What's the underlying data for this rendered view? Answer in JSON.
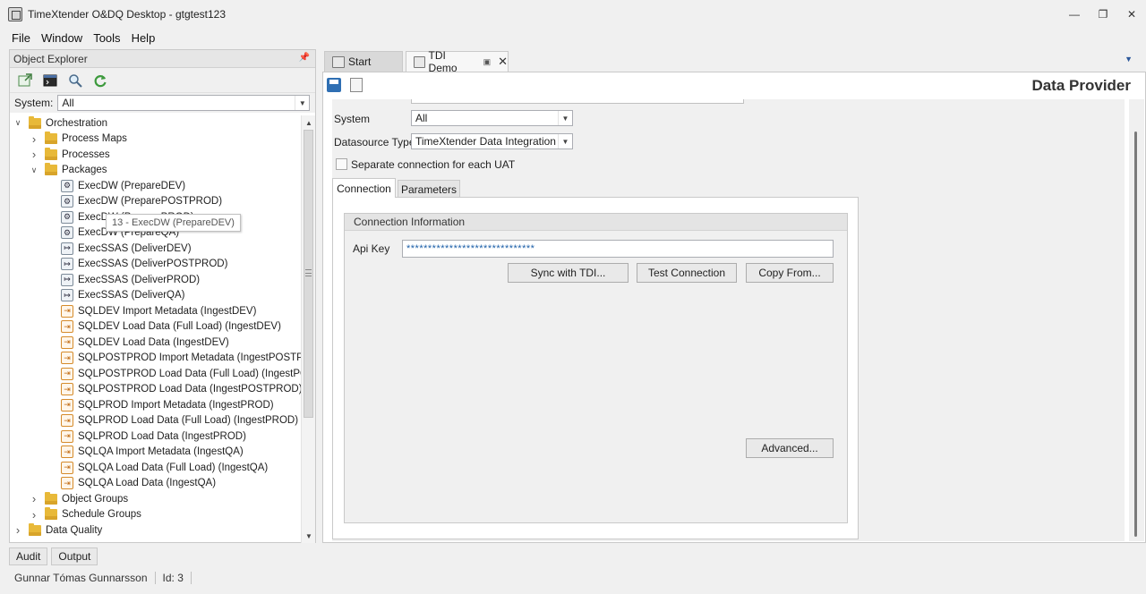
{
  "window": {
    "title": "TimeXtender O&DQ Desktop - gtgtest123"
  },
  "menu": [
    "File",
    "Window",
    "Tools",
    "Help"
  ],
  "explorer": {
    "header": "Object Explorer",
    "system_label": "System:",
    "system_value": "All",
    "tooltip": "13 - ExecDW (PrepareDEV)",
    "tree": [
      {
        "label": "Orchestration",
        "level": 0,
        "icon": "folder",
        "expander": "expanded"
      },
      {
        "label": "Process Maps",
        "level": 1,
        "icon": "folder",
        "expander": "collapsed"
      },
      {
        "label": "Processes",
        "level": 1,
        "icon": "folder",
        "expander": "collapsed"
      },
      {
        "label": "Packages",
        "level": 1,
        "icon": "folder",
        "expander": "expanded"
      },
      {
        "label": "ExecDW (PrepareDEV)",
        "level": 2,
        "icon": "gear-package"
      },
      {
        "label": "ExecDW (PreparePOSTPROD)",
        "level": 2,
        "icon": "gear-package"
      },
      {
        "label": "ExecDW (PreparePROD)",
        "level": 2,
        "icon": "gear-package"
      },
      {
        "label": "ExecDW (PrepareQA)",
        "level": 2,
        "icon": "gear-package"
      },
      {
        "label": "ExecSSAS (DeliverDEV)",
        "level": 2,
        "icon": "ssas-package"
      },
      {
        "label": "ExecSSAS (DeliverPOSTPROD)",
        "level": 2,
        "icon": "ssas-package"
      },
      {
        "label": "ExecSSAS (DeliverPROD)",
        "level": 2,
        "icon": "ssas-package"
      },
      {
        "label": "ExecSSAS (DeliverQA)",
        "level": 2,
        "icon": "ssas-package"
      },
      {
        "label": "SQLDEV Import Metadata (IngestDEV)",
        "level": 2,
        "icon": "ingest-package"
      },
      {
        "label": "SQLDEV Load Data (Full Load) (IngestDEV)",
        "level": 2,
        "icon": "ingest-package"
      },
      {
        "label": "SQLDEV Load Data (IngestDEV)",
        "level": 2,
        "icon": "ingest-package"
      },
      {
        "label": "SQLPOSTPROD Import Metadata (IngestPOSTPRO...",
        "level": 2,
        "icon": "ingest-package"
      },
      {
        "label": "SQLPOSTPROD Load Data (Full Load) (IngestPOST...",
        "level": 2,
        "icon": "ingest-package"
      },
      {
        "label": "SQLPOSTPROD Load Data (IngestPOSTPROD)",
        "level": 2,
        "icon": "ingest-package"
      },
      {
        "label": "SQLPROD Import Metadata (IngestPROD)",
        "level": 2,
        "icon": "ingest-package"
      },
      {
        "label": "SQLPROD Load Data (Full Load) (IngestPROD)",
        "level": 2,
        "icon": "ingest-package"
      },
      {
        "label": "SQLPROD Load Data (IngestPROD)",
        "level": 2,
        "icon": "ingest-package"
      },
      {
        "label": "SQLQA Import Metadata (IngestQA)",
        "level": 2,
        "icon": "ingest-package"
      },
      {
        "label": "SQLQA Load Data (Full Load) (IngestQA)",
        "level": 2,
        "icon": "ingest-package"
      },
      {
        "label": "SQLQA Load Data (IngestQA)",
        "level": 2,
        "icon": "ingest-package"
      },
      {
        "label": "Object Groups",
        "level": 1,
        "icon": "folder",
        "expander": "collapsed"
      },
      {
        "label": "Schedule Groups",
        "level": 1,
        "icon": "folder",
        "expander": "collapsed"
      },
      {
        "label": "Data Quality",
        "level": 0,
        "icon": "folder",
        "expander": "collapsed"
      }
    ]
  },
  "bottom_tabs": [
    "Audit",
    "Output"
  ],
  "status": {
    "user": "Gunnar Tómas Gunnarsson",
    "id": "Id: 3"
  },
  "doc_tabs": {
    "start": "Start",
    "active": "TDI Demo"
  },
  "doc": {
    "title": "Data Provider",
    "system_label": "System",
    "system_value": "All",
    "datasource_label": "Datasource Type",
    "datasource_value": "TimeXtender Data Integration",
    "separate_conn_label": "Separate connection for each UAT",
    "tabs": [
      "Connection",
      "Parameters"
    ],
    "group_title": "Connection Information",
    "api_key_label": "Api Key",
    "api_key_value": "******************************",
    "buttons": {
      "sync": "Sync with TDI...",
      "test": "Test Connection",
      "copy_from": "Copy From...",
      "advanced": "Advanced..."
    }
  },
  "colors": {
    "folder": "#e8b939",
    "accent": "#2b579a",
    "api_key_text": "#1c5fa8"
  }
}
